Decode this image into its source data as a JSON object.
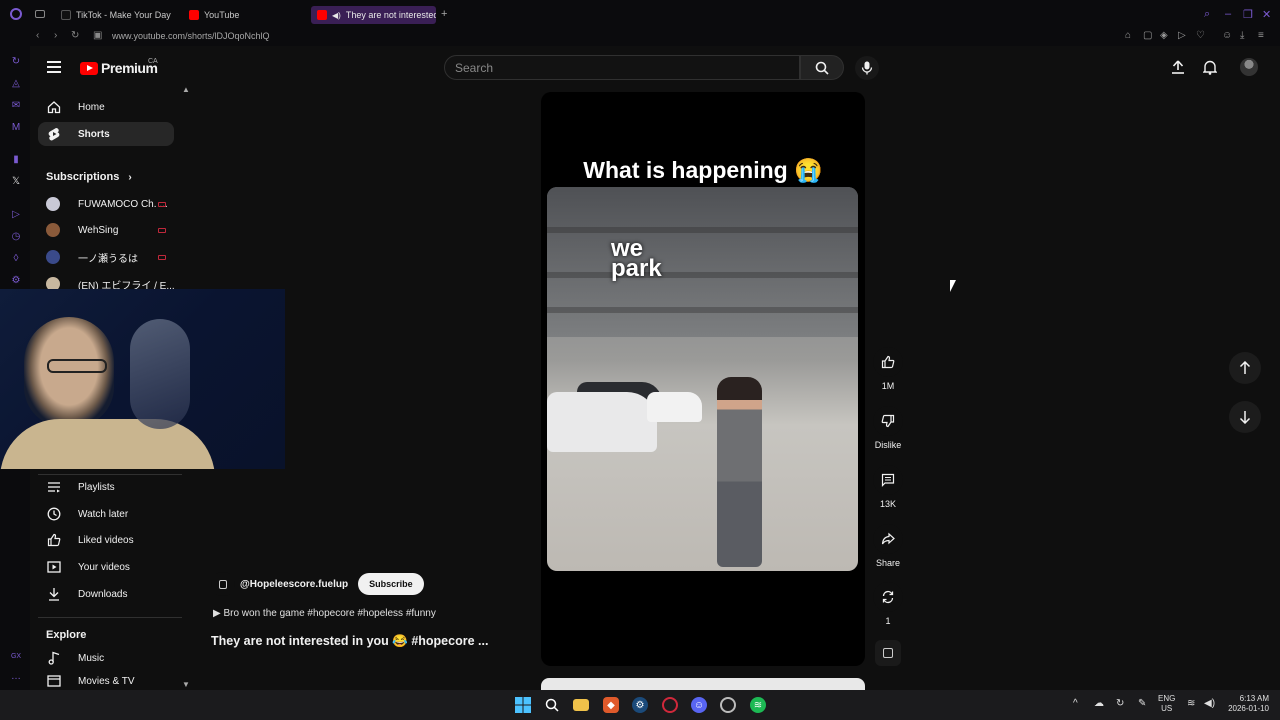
{
  "browser": {
    "tabs": [
      {
        "label": "TikTok - Make Your Day",
        "icon": "tiktok-icon"
      },
      {
        "label": "YouTube",
        "icon": "youtube-icon"
      },
      {
        "label": "They are not interested",
        "icon": "youtube-icon",
        "active": true
      }
    ],
    "url": "www.youtube.com/shorts/lDJOqoNchlQ"
  },
  "header": {
    "logo_text": "Premium",
    "country_code": "CA",
    "search_placeholder": "Search"
  },
  "guide": {
    "main": [
      {
        "label": "Home",
        "icon": "home-icon"
      },
      {
        "label": "Shorts",
        "icon": "shorts-icon",
        "active": true
      }
    ],
    "subscriptions_title": "Subscriptions",
    "subscriptions": [
      {
        "label": "FUWAMOCO Ch. ...",
        "color": "#c9c9d6"
      },
      {
        "label": "WehSing",
        "color": "#8a5a3a"
      },
      {
        "label": "一ノ瀬うるは",
        "color": "#3a4a8a"
      },
      {
        "label": "(EN) エビフライ / E...",
        "color": "#c8b8a0"
      }
    ],
    "you": [
      {
        "label": "Playlists",
        "icon": "playlist-icon"
      },
      {
        "label": "Watch later",
        "icon": "clock-icon"
      },
      {
        "label": "Liked videos",
        "icon": "thumbs-up-icon"
      },
      {
        "label": "Your videos",
        "icon": "video-icon"
      },
      {
        "label": "Downloads",
        "icon": "download-icon"
      }
    ],
    "explore_title": "Explore",
    "explore": [
      {
        "label": "Music",
        "icon": "music-icon"
      },
      {
        "label": "Movies & TV",
        "icon": "film-icon"
      }
    ]
  },
  "short": {
    "title_overlay": "What is happening 😭",
    "video_caption": "we park",
    "channel": "@Hopeleescore.fuelup",
    "subscribe_label": "Subscribe",
    "description": "▶ Bro won the game #hopecore #hopeless #funny",
    "caption": "They are not interested in you 😂 #hopecore ...",
    "actions": {
      "likes": "1M",
      "dislike": "Dislike",
      "comments": "13K",
      "share": "Share",
      "remix": "1"
    }
  },
  "taskbar": {
    "lang_line1": "ENG",
    "lang_line2": "US",
    "time": "6:13 AM",
    "date": "2026-01-10"
  }
}
